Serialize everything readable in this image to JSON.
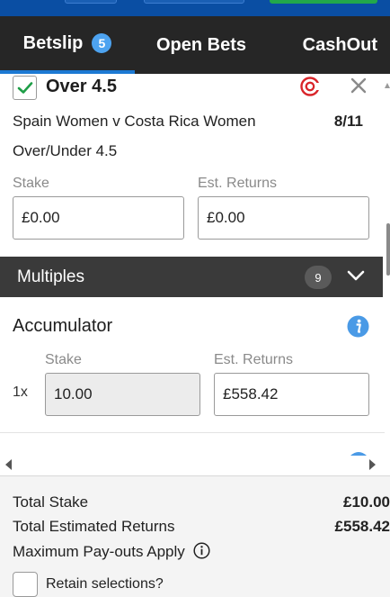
{
  "tabs": {
    "betslip_label": "Betslip",
    "betslip_count": "5",
    "open_bets_label": "Open Bets",
    "cashout_label": "CashOut"
  },
  "selection": {
    "title": "Over 4.5",
    "event": "Spain Women v Costa Rica Women",
    "odds": "8/11",
    "market": "Over/Under 4.5",
    "stake_label": "Stake",
    "stake_value": "£0.00",
    "returns_label": "Est. Returns",
    "returns_value": "£0.00",
    "checked": true,
    "icons": [
      "checkmark-icon",
      "target-icon",
      "close-icon"
    ]
  },
  "multiples": {
    "label": "Multiples",
    "count": "9",
    "icon": "chevron-down-icon"
  },
  "accumulator": {
    "title": "Accumulator",
    "multiplier": "1x",
    "stake_label": "Stake",
    "stake_value": "10.00",
    "returns_label": "Est. Returns",
    "returns_value": "£558.42",
    "icon": "info-icon"
  },
  "footer": {
    "total_stake_label": "Total Stake",
    "total_stake_value": "£10.00",
    "total_returns_label": "Total Estimated Returns",
    "total_returns_value": "£558.42",
    "max_payout_label": "Maximum Pay-outs Apply",
    "retain_label": "Retain selections?"
  },
  "colors": {
    "header_bg": "#262626",
    "accent_blue": "#1c79d3",
    "multiples_bg": "#3a3a3a",
    "check_green": "#1e9e47",
    "target_red": "#d9262b"
  }
}
